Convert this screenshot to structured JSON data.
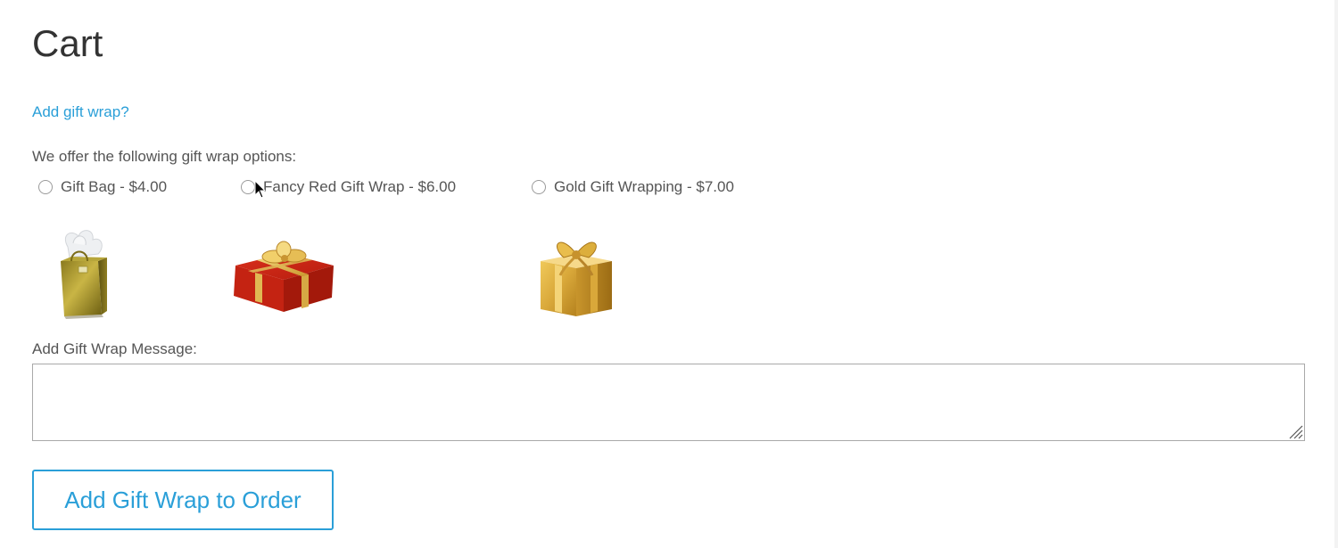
{
  "page": {
    "title": "Cart"
  },
  "gift_wrap": {
    "link_label": "Add gift wrap?",
    "intro": "We offer the following gift wrap options:",
    "options": [
      {
        "label": "Gift Bag - $4.00",
        "selected": false,
        "image": "gold-gift-bag"
      },
      {
        "label": "Fancy Red Gift Wrap - $6.00",
        "selected": false,
        "image": "red-gift-box"
      },
      {
        "label": "Gold Gift Wrapping - $7.00",
        "selected": false,
        "image": "gold-gift-box"
      }
    ],
    "message_label": "Add Gift Wrap Message:",
    "message_value": "",
    "submit_label": "Add Gift Wrap to Order"
  },
  "colors": {
    "accent": "#2a9fd8",
    "text": "#555555",
    "title": "#333333",
    "border": "#a9a9a9"
  }
}
